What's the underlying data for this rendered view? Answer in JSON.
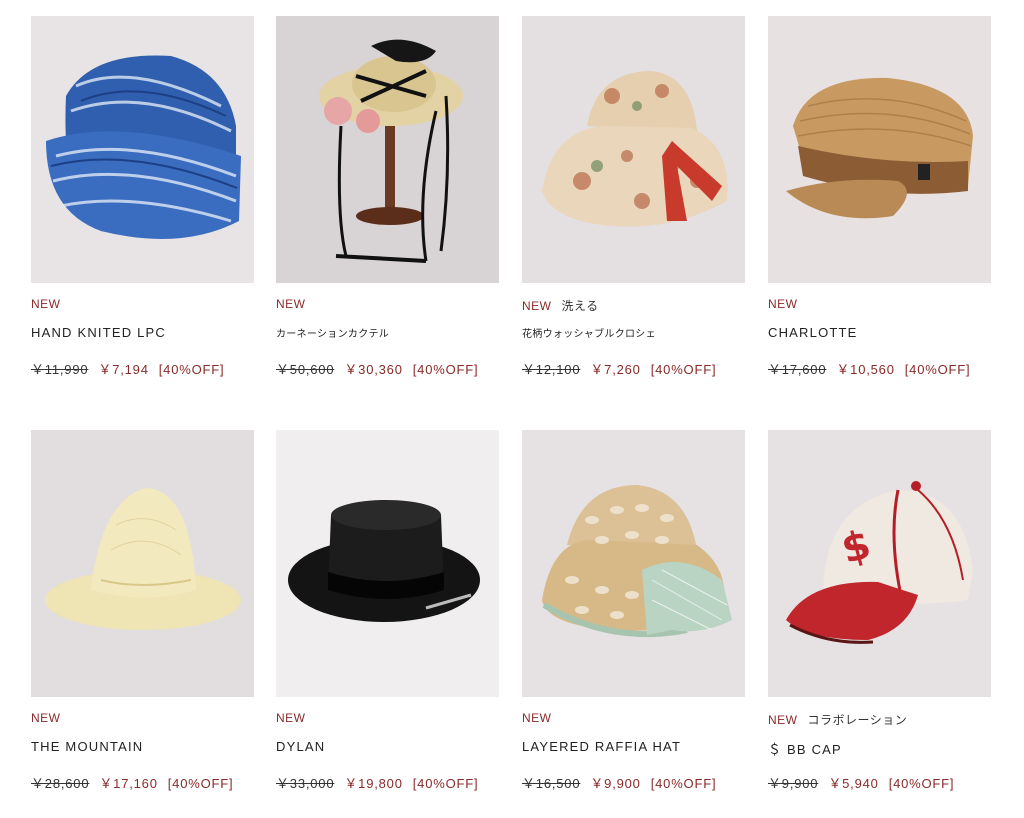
{
  "products": [
    {
      "new_label": "NEW",
      "extra_tag": "",
      "name": "HAND KNITED LPC",
      "old_price": "￥11,990",
      "price": "￥7,194",
      "discount": "[40%OFF]",
      "image_icon": "knit-beanie"
    },
    {
      "new_label": "NEW",
      "extra_tag": "",
      "name": "カーネーションカクテル",
      "old_price": "￥50,600",
      "price": "￥30,360",
      "discount": "[40%OFF]",
      "image_icon": "boater-hat-on-stand"
    },
    {
      "new_label": "NEW",
      "extra_tag": "洗える",
      "name": "花柄ウォッシャブルクロシェ",
      "old_price": "￥12,100",
      "price": "￥7,260",
      "discount": "[40%OFF]",
      "image_icon": "floral-bucket-hat"
    },
    {
      "new_label": "NEW",
      "extra_tag": "",
      "name": "CHARLOTTE",
      "old_price": "￥17,600",
      "price": "￥10,560",
      "discount": "[40%OFF]",
      "image_icon": "straw-marine-cap"
    },
    {
      "new_label": "NEW",
      "extra_tag": "",
      "name": "THE MOUNTAIN",
      "old_price": "￥28,600",
      "price": "￥17,160",
      "discount": "[40%OFF]",
      "image_icon": "cream-mountain-hat"
    },
    {
      "new_label": "NEW",
      "extra_tag": "",
      "name": "DYLAN",
      "old_price": "￥33,000",
      "price": "￥19,800",
      "discount": "[40%OFF]",
      "image_icon": "black-porkpie-hat"
    },
    {
      "new_label": "NEW",
      "extra_tag": "",
      "name": "LAYERED RAFFIA HAT",
      "old_price": "￥16,500",
      "price": "￥9,900",
      "discount": "[40%OFF]",
      "image_icon": "raffia-bucket-hat"
    },
    {
      "new_label": "NEW",
      "extra_tag": "コラボレーション",
      "name": "＄ BB CAP",
      "old_price": "￥9,900",
      "price": "￥5,940",
      "discount": "[40%OFF]",
      "image_icon": "baseball-cap"
    }
  ],
  "colors": {
    "accent": "#8a2a2a",
    "image_bg": "#e9e5e6"
  }
}
